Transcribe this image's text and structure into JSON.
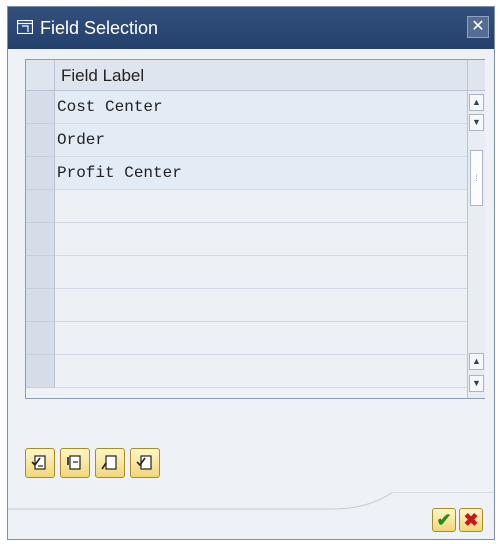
{
  "dialog": {
    "title": "Field Selection",
    "close_glyph": "✕"
  },
  "table": {
    "column_header": "Field Label",
    "rows": [
      "Cost Center",
      "Order",
      "Profit Center",
      "",
      "",
      "",
      "",
      "",
      ""
    ]
  },
  "scrollbar": {
    "up_glyph": "▲",
    "down_glyph": "▼",
    "thumb_glyph": "⁞"
  },
  "toolbar": {
    "icons": [
      "select-all-icon",
      "deselect-all-icon",
      "select-block-icon",
      "find-icon"
    ]
  },
  "footer": {
    "ok_glyph": "✔",
    "cancel_glyph": "✖"
  },
  "colors": {
    "titlebar": "#2a4573",
    "button_fill": "#f5dc82",
    "ok_green": "#2a8a1a",
    "cancel_red": "#c41a1a"
  }
}
